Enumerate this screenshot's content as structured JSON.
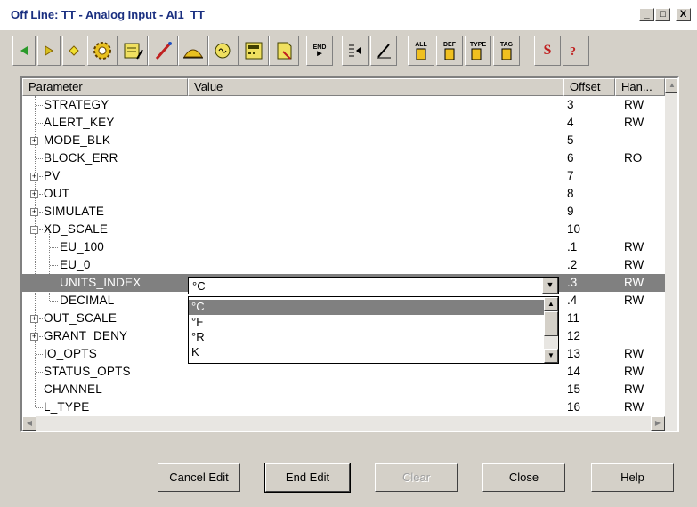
{
  "window": {
    "title": "Off Line: TT - Analog Input - AI1_TT",
    "min_symbol": "_",
    "max_symbol": "□",
    "close_symbol": "X"
  },
  "toolbar": {
    "tools": [
      {
        "icon": "back-arrow-icon"
      },
      {
        "icon": "forward-arrow-icon"
      },
      {
        "icon": "diamond-icon"
      },
      {
        "icon": "gears-icon"
      },
      {
        "icon": "form-edit-icon"
      },
      {
        "icon": "probe-icon"
      },
      {
        "icon": "hill-icon"
      },
      {
        "icon": "wave-icon"
      },
      {
        "icon": "calculator-icon"
      },
      {
        "icon": "document-icon"
      },
      {
        "icon": "end-cursor-icon",
        "label": "END"
      },
      {
        "icon": "list-insert-icon"
      },
      {
        "icon": "pen-icon"
      },
      {
        "icon": "all-blocks-icon",
        "label": "ALL"
      },
      {
        "icon": "def-blocks-icon",
        "label": "DEF"
      },
      {
        "icon": "type-blocks-icon",
        "label": "TYPE"
      },
      {
        "icon": "tag-blocks-icon",
        "label": "TAG"
      },
      {
        "icon": "s-icon",
        "label": "S"
      },
      {
        "icon": "help-cursor-icon"
      }
    ]
  },
  "grid": {
    "columns": {
      "parameter": "Parameter",
      "value": "Value",
      "offset": "Offset",
      "handling": "Han..."
    },
    "rows": [
      {
        "name": "STRATEGY",
        "offset": "3",
        "handling": "RW"
      },
      {
        "name": "ALERT_KEY",
        "offset": "4",
        "handling": "RW"
      },
      {
        "name": "MODE_BLK",
        "offset": "5",
        "handling": "",
        "expander": "+"
      },
      {
        "name": "BLOCK_ERR",
        "offset": "6",
        "handling": "RO"
      },
      {
        "name": "PV",
        "offset": "7",
        "handling": "",
        "expander": "+"
      },
      {
        "name": "OUT",
        "offset": "8",
        "handling": "",
        "expander": "+"
      },
      {
        "name": "SIMULATE",
        "offset": "9",
        "handling": "",
        "expander": "+"
      },
      {
        "name": "XD_SCALE",
        "offset": "10",
        "handling": "",
        "expander": "−"
      },
      {
        "name": "EU_100",
        "offset": ".1",
        "handling": "RW",
        "child": true
      },
      {
        "name": "EU_0",
        "offset": ".2",
        "handling": "RW",
        "child": true
      },
      {
        "name": "UNITS_INDEX",
        "offset": ".3",
        "handling": "RW",
        "child": true,
        "selected": true
      },
      {
        "name": "DECIMAL",
        "offset": ".4",
        "handling": "RW",
        "child": true
      },
      {
        "name": "OUT_SCALE",
        "offset": "11",
        "handling": "",
        "expander": "+"
      },
      {
        "name": "GRANT_DENY",
        "offset": "12",
        "handling": "",
        "expander": "+"
      },
      {
        "name": "IO_OPTS",
        "offset": "13",
        "handling": "RW"
      },
      {
        "name": "STATUS_OPTS",
        "offset": "14",
        "handling": "RW"
      },
      {
        "name": "CHANNEL",
        "offset": "15",
        "handling": "RW"
      },
      {
        "name": "L_TYPE",
        "offset": "16",
        "handling": "RW"
      }
    ]
  },
  "editor": {
    "current_value": "°C",
    "options": [
      "°C",
      "°F",
      "°R",
      "K"
    ],
    "highlighted_option": "°C"
  },
  "buttons": {
    "cancel_edit": "Cancel Edit",
    "end_edit": "End Edit",
    "clear": "Clear",
    "close": "Close",
    "help": "Help"
  },
  "colors": {
    "title_text": "#1a2f80",
    "selection": "#808080",
    "chrome": "#d4d0c8"
  }
}
